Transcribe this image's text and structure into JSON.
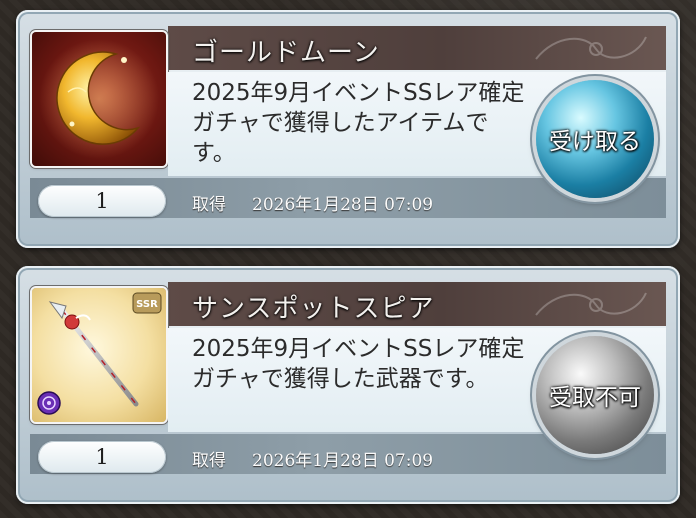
{
  "items": [
    {
      "name": "ゴールドムーン",
      "description": "2025年9月イベントSSレア確定ガチャで獲得したアイテムです。",
      "quantity": "1",
      "acquired_label": "取得",
      "acquired_date": "2026年1月28日 07:09",
      "action_label": "受け取る",
      "action_enabled": true,
      "icon": "gold-crescent-moon-icon"
    },
    {
      "name": "サンスポットスピア",
      "description": "2025年9月イベントSSレア確定ガチャで獲得した武器です。",
      "quantity": "1",
      "acquired_label": "取得",
      "acquired_date": "2026年1月28日 07:09",
      "action_label": "受取不可",
      "action_enabled": false,
      "icon": "spear-weapon-icon",
      "rarity_badge": "SSR"
    }
  ]
}
